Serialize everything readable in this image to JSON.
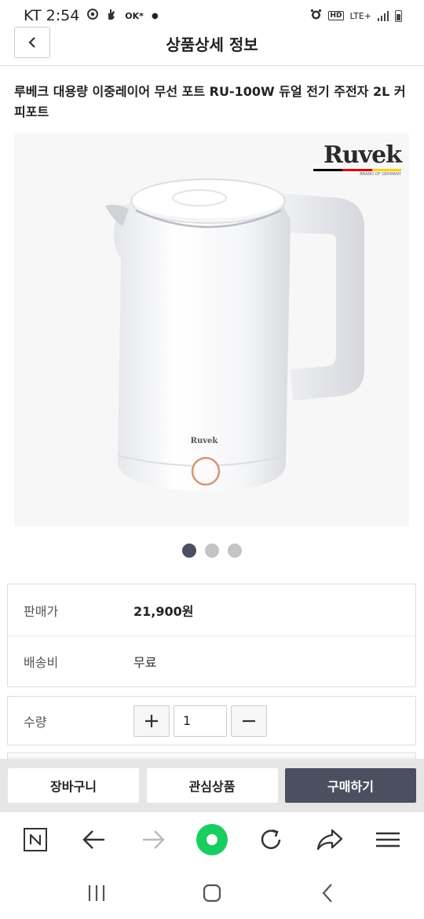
{
  "status_bar": {
    "carrier_time": "KT 2:54",
    "network": "LTE+",
    "ok_label": "OK*",
    "icons": [
      "chrome-icon",
      "hand-icon",
      "ok-cashbag-icon",
      "dot-icon",
      "alarm-icon",
      "hd-icon",
      "signal-icon",
      "battery-icon"
    ]
  },
  "header": {
    "title": "상품상세 정보",
    "back_icon": "chevron-left-icon"
  },
  "product": {
    "title": "루베크 대용량 이중레이어 무선 포트 RU-100W 듀얼 전기 주전자 2L 커피포트",
    "brand_logo": "Ruvek",
    "brand_sub": "BRAND OF GERMANY",
    "kettle_badge": "Ruvek",
    "image_count": 3,
    "active_image": 1
  },
  "info": {
    "price_label": "판매가",
    "price_value": "21,900원",
    "shipping_label": "배송비",
    "shipping_value": "무료"
  },
  "quantity": {
    "label": "수량",
    "value": "1",
    "plus_icon": "plus-icon",
    "minus_icon": "minus-icon"
  },
  "actions": {
    "cart": "장바구니",
    "wishlist": "관심상품",
    "buy": "구매하기"
  },
  "colors": {
    "accent_dark": "#4a5060",
    "naver_green": "#19ce60",
    "flag": [
      "#000000",
      "#dd0000",
      "#ffce00"
    ]
  },
  "browser_toolbar": [
    "naver-home-icon",
    "back-arrow-icon",
    "forward-arrow-icon",
    "green-dot-icon",
    "refresh-icon",
    "share-icon",
    "menu-icon"
  ],
  "system_nav": [
    "recent-apps-icon",
    "home-icon",
    "system-back-icon"
  ]
}
